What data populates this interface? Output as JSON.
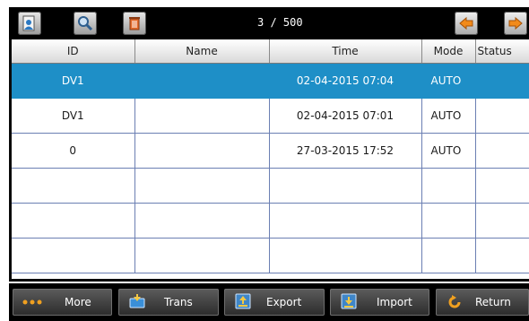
{
  "toolbar": {
    "counter": "3 / 500",
    "buttons": [
      {
        "icon": "user-record-icon"
      },
      {
        "icon": "search-icon"
      },
      {
        "icon": "trash-icon"
      },
      {
        "icon": "arrow-left-icon"
      },
      {
        "icon": "arrow-right-icon"
      }
    ]
  },
  "table": {
    "headers": [
      "ID",
      "Name",
      "Time",
      "Mode",
      "Status"
    ],
    "rows": [
      {
        "id": "DV1",
        "name": "",
        "time": "02-04-2015 07:04",
        "mode": "AUTO",
        "status": "",
        "selected": true
      },
      {
        "id": "DV1",
        "name": "",
        "time": "02-04-2015 07:01",
        "mode": "AUTO",
        "status": "",
        "selected": false
      },
      {
        "id": "0",
        "name": "",
        "time": "27-03-2015 17:52",
        "mode": "AUTO",
        "status": "",
        "selected": false
      },
      {
        "id": "",
        "name": "",
        "time": "",
        "mode": "",
        "status": "",
        "selected": false
      },
      {
        "id": "",
        "name": "",
        "time": "",
        "mode": "",
        "status": "",
        "selected": false
      },
      {
        "id": "",
        "name": "",
        "time": "",
        "mode": "",
        "status": "",
        "selected": false
      }
    ]
  },
  "bottom": {
    "more_label": "More",
    "trans_label": "Trans",
    "export_label": "Export",
    "import_label": "Import",
    "return_label": "Return"
  },
  "colors": {
    "selected_row": "#1e8fc7",
    "grid_line": "#6b7fb3",
    "toolbar_bg": "#000000",
    "arrow_orange": "#f28a1a"
  }
}
